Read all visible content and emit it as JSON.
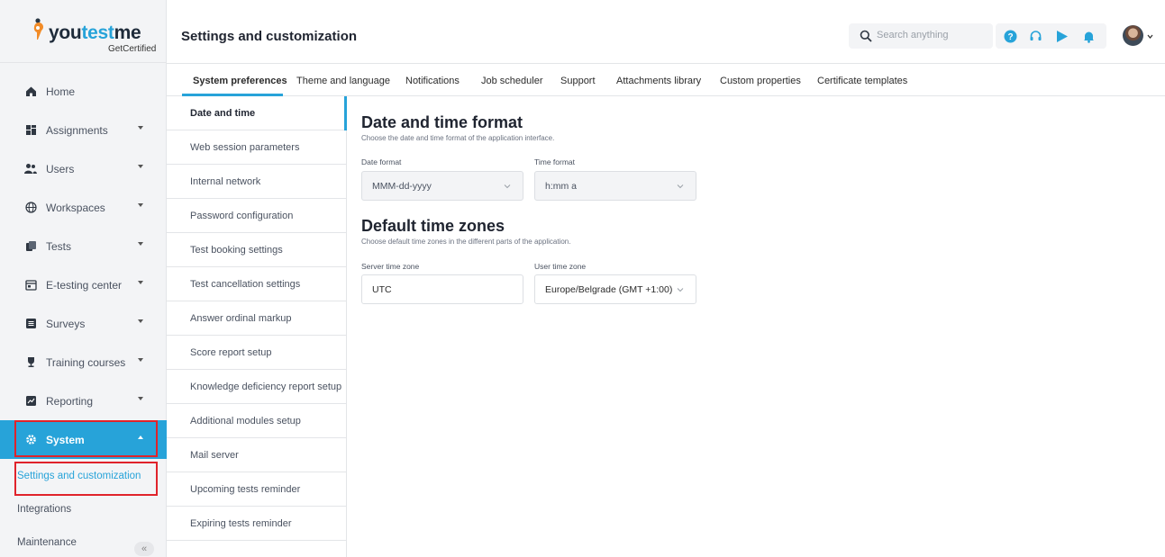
{
  "brand": {
    "name_part1": "you",
    "name_part2": "test",
    "name_part3": "me",
    "sub": "GetCertified",
    "accent_color": "#27a3d9"
  },
  "sidebar": {
    "items": [
      {
        "label": "Home",
        "icon": "home-icon",
        "has_chevron": false
      },
      {
        "label": "Assignments",
        "icon": "assignments-icon",
        "has_chevron": true
      },
      {
        "label": "Users",
        "icon": "users-icon",
        "has_chevron": true
      },
      {
        "label": "Workspaces",
        "icon": "globe-icon",
        "has_chevron": true
      },
      {
        "label": "Tests",
        "icon": "tests-icon",
        "has_chevron": true
      },
      {
        "label": "E-testing center",
        "icon": "calendar-icon",
        "has_chevron": true
      },
      {
        "label": "Surveys",
        "icon": "surveys-icon",
        "has_chevron": true
      },
      {
        "label": "Training courses",
        "icon": "trophy-icon",
        "has_chevron": true
      },
      {
        "label": "Reporting",
        "icon": "reporting-icon",
        "has_chevron": true
      },
      {
        "label": "System",
        "icon": "gear-icon",
        "has_chevron": true,
        "active": true
      }
    ],
    "sub_items": [
      {
        "label": "Settings and customization",
        "current": true
      },
      {
        "label": "Integrations"
      },
      {
        "label": "Maintenance"
      }
    ],
    "collapse_glyph": "«"
  },
  "header": {
    "title": "Settings and customization",
    "search_placeholder": "Search anything"
  },
  "tabs": [
    {
      "label": "System preferences",
      "active": true
    },
    {
      "label": "Theme and language"
    },
    {
      "label": "Notifications"
    },
    {
      "label": "Job scheduler"
    },
    {
      "label": "Support"
    },
    {
      "label": "Attachments library"
    },
    {
      "label": "Custom properties"
    },
    {
      "label": "Certificate templates"
    }
  ],
  "subnav": [
    {
      "label": "Date and time",
      "active": true
    },
    {
      "label": "Web session parameters"
    },
    {
      "label": "Internal network"
    },
    {
      "label": "Password configuration"
    },
    {
      "label": "Test booking settings"
    },
    {
      "label": "Test cancellation settings"
    },
    {
      "label": "Answer ordinal markup"
    },
    {
      "label": "Score report setup"
    },
    {
      "label": "Knowledge deficiency report setup"
    },
    {
      "label": "Additional modules setup"
    },
    {
      "label": "Mail server"
    },
    {
      "label": "Upcoming tests reminder"
    },
    {
      "label": "Expiring tests reminder"
    }
  ],
  "date_time_format": {
    "title": "Date and time format",
    "description": "Choose the date and time format of the application interface.",
    "date_format_label": "Date format",
    "date_format_value": "MMM-dd-yyyy",
    "time_format_label": "Time format",
    "time_format_value": "h:mm a"
  },
  "time_zones": {
    "title": "Default time zones",
    "description": "Choose default time zones in the different parts of the application.",
    "server_label": "Server time zone",
    "server_value": "UTC",
    "user_label": "User time zone",
    "user_value": "Europe/Belgrade (GMT +1:00)"
  }
}
